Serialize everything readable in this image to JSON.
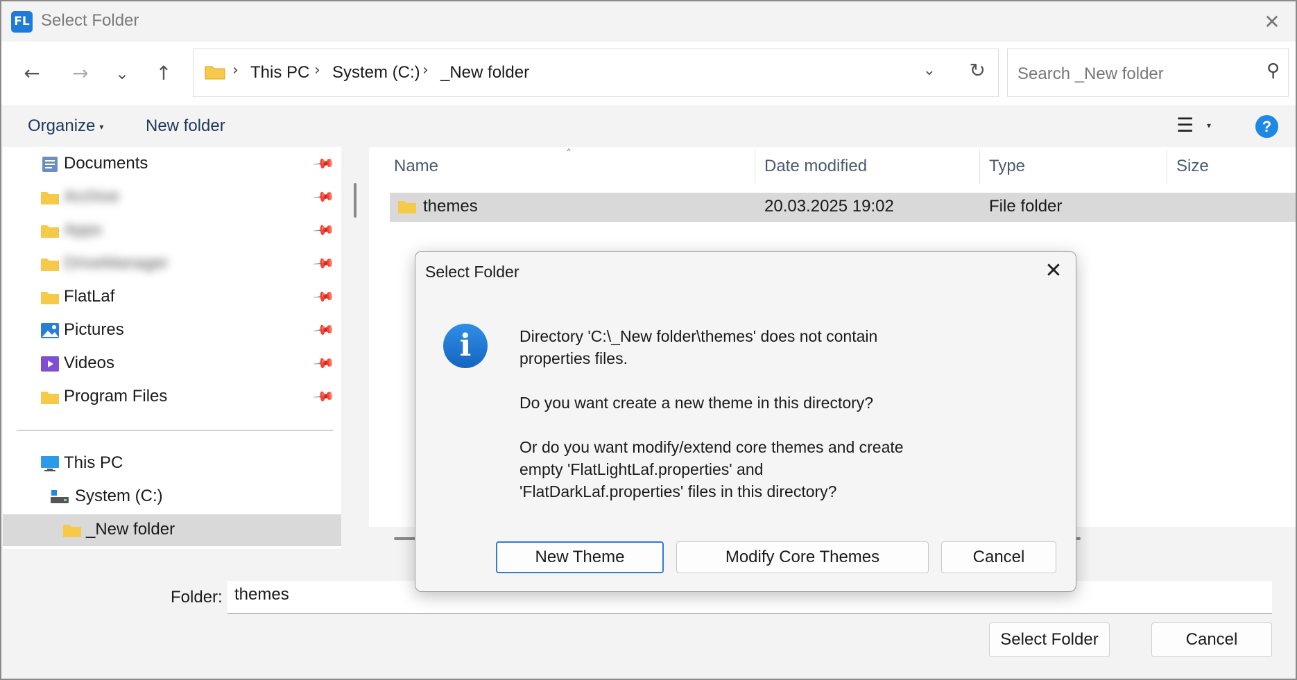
{
  "window": {
    "title": "Select Folder",
    "app_icon_text": "FL",
    "close_glyph": "✕"
  },
  "nav": {
    "back_glyph": "←",
    "forward_glyph": "→",
    "recent_glyph": "⌄",
    "up_glyph": "↑",
    "breadcrumbs": [
      "This PC",
      "System (C:)",
      "_New folder"
    ],
    "breadcrumb_sep": "›",
    "dropdown_glyph": "⌄",
    "refresh_glyph": "↻",
    "search_placeholder": "Search _New folder",
    "search_glyph": "⚲"
  },
  "toolbar": {
    "organize_label": "Organize",
    "organize_caret": "▾",
    "new_folder_label": "New folder",
    "view_glyph": "☰",
    "view_caret": "▾",
    "help_glyph": "?"
  },
  "sidebar": {
    "pin_glyph": "📌",
    "items": [
      {
        "label": "Documents",
        "icon": "documents-icon",
        "pinned": true
      },
      {
        "label": "Archive",
        "icon": "folder-icon",
        "pinned": true,
        "blurred": true
      },
      {
        "label": "Apps",
        "icon": "folder-icon",
        "pinned": true,
        "blurred": true
      },
      {
        "label": "DriveManager",
        "icon": "folder-icon",
        "pinned": true,
        "blurred": true
      },
      {
        "label": "FlatLaf",
        "icon": "folder-icon",
        "pinned": true
      },
      {
        "label": "Pictures",
        "icon": "pictures-icon",
        "pinned": true
      },
      {
        "label": "Videos",
        "icon": "videos-icon",
        "pinned": true
      },
      {
        "label": "Program Files",
        "icon": "folder-icon",
        "pinned": true
      }
    ],
    "tree": [
      {
        "label": "This PC",
        "icon": "computer-icon"
      },
      {
        "label": "System (C:)",
        "icon": "drive-icon"
      },
      {
        "label": "_New folder",
        "icon": "folder-icon",
        "selected": true
      }
    ]
  },
  "files": {
    "columns": [
      "Name",
      "Date modified",
      "Type",
      "Size"
    ],
    "sort_glyph": "˄",
    "rows": [
      {
        "name": "themes",
        "date": "20.03.2025 19:02",
        "type": "File folder",
        "size": ""
      }
    ]
  },
  "footer": {
    "folder_label": "Folder:",
    "folder_value": "themes",
    "select_label": "Select Folder",
    "cancel_label": "Cancel"
  },
  "dialog": {
    "title": "Select Folder",
    "close_glyph": "✕",
    "info_glyph": "i",
    "message_line1": "Directory 'C:\\_New folder\\themes' does not contain",
    "message_line2": "properties files.",
    "message_line3": "Do you want create a new theme in this directory?",
    "message_line4": "Or do you want modify/extend core themes and create",
    "message_line5": "empty 'FlatLightLaf.properties' and",
    "message_line6": "'FlatDarkLaf.properties' files in this directory?",
    "new_theme_label": "New Theme",
    "modify_label": "Modify Core Themes",
    "cancel_label": "Cancel"
  },
  "colors": {
    "accent": "#1e88e5",
    "selection": "#d9d9d9",
    "folder": "#f7c948"
  }
}
